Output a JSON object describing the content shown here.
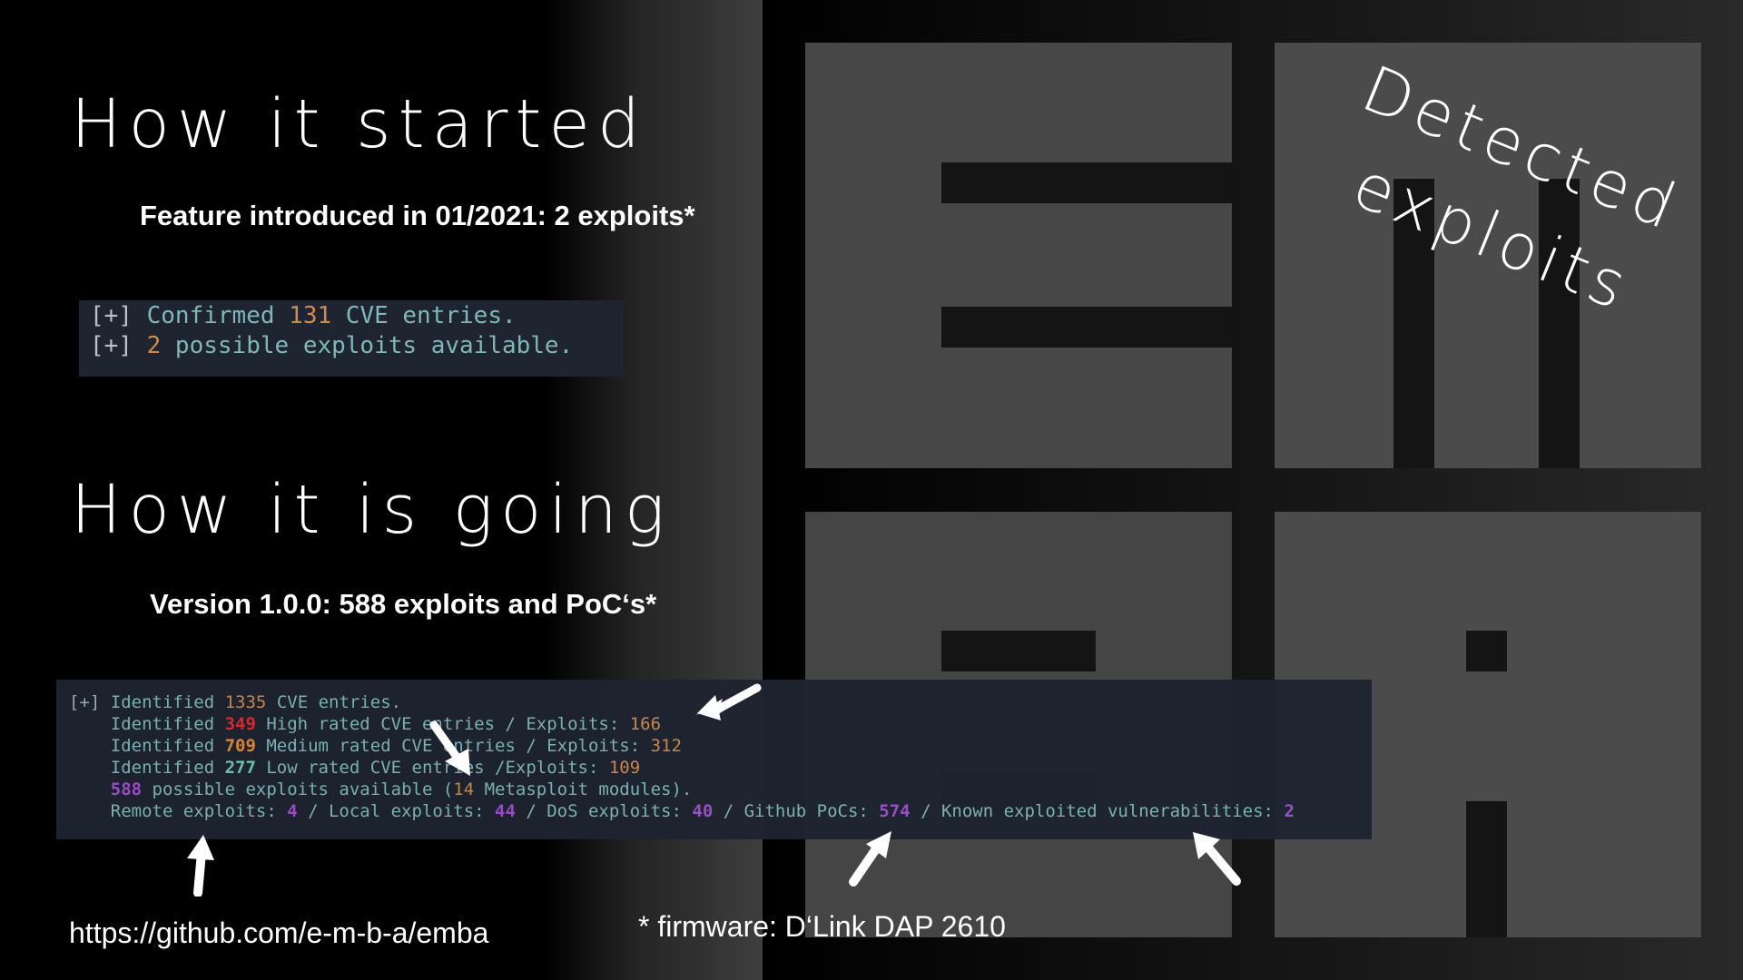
{
  "slide": {
    "heading_started": "How it started",
    "subtitle_started": "Feature introduced in 01/2021: 2 exploits*",
    "terminal_old": {
      "line1": {
        "prefix": "[+] ",
        "text_a": "Confirmed ",
        "num": "131",
        "text_b": " CVE entries."
      },
      "line2": {
        "prefix": "[+] ",
        "num": "2",
        "text_b": " possible exploits available."
      }
    },
    "heading_going": "How it is going",
    "subtitle_going": "Version 1.0.0: 588 exploits and PoC‘s*",
    "terminal_new": {
      "l1": {
        "prefix": "[+] ",
        "a": "Identified ",
        "num": "1335",
        "b": " CVE entries."
      },
      "l2": {
        "a": "    Identified ",
        "num": "349",
        "b": " High rated CVE entries / Exploits: ",
        "num2": "166"
      },
      "l3": {
        "a": "    Identified ",
        "num": "709",
        "b": " Medium rated CVE entries / Exploits: ",
        "num2": "312"
      },
      "l4": {
        "a": "    Identified ",
        "num": "277",
        "b": " Low rated CVE entries /Exploits: ",
        "num2": "109"
      },
      "l5": {
        "a": "    ",
        "num": "588",
        "b": " possible exploits available (",
        "num2": "14",
        "c": " Metasploit modules)."
      },
      "l6": {
        "a": "    Remote exploits: ",
        "n1": "4",
        "b": " / Local exploits: ",
        "n2": "44",
        "c": " / DoS exploits: ",
        "n3": "40",
        "d": " / Github PoCs: ",
        "n4": "574",
        "e": " / Known exploited vulnerabilities: ",
        "n5": "2"
      }
    },
    "github_url": "https://github.com/e-m-b-a/emba",
    "firmware_note": "* firmware: D‘Link DAP 2610",
    "detected_line1": "Detected",
    "detected_line2": "exploits"
  },
  "colors": {
    "logo_block": "#4a4a4a",
    "terminal_bg": "#1e2430",
    "high": "#e02b2b",
    "medium": "#e08a3a",
    "low": "#6fc8b0",
    "exploit_count": "#a04fd0"
  }
}
